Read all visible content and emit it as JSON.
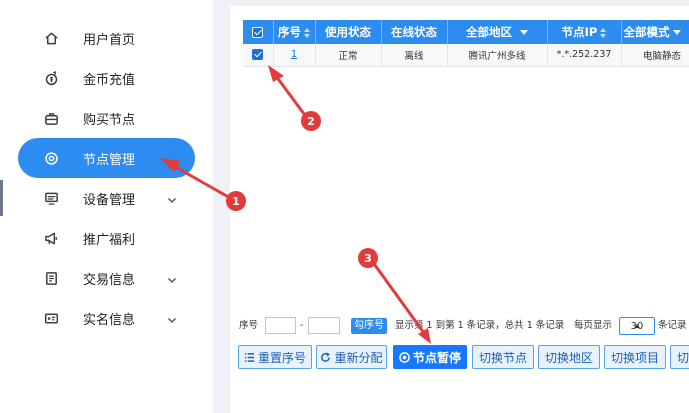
{
  "sidebar": {
    "items": [
      {
        "label": "用户首页",
        "icon": "home-icon"
      },
      {
        "label": "金币充值",
        "icon": "coin-icon"
      },
      {
        "label": "购买节点",
        "icon": "briefcase-icon"
      },
      {
        "label": "节点管理",
        "icon": "node-icon",
        "active": true
      },
      {
        "label": "设备管理",
        "icon": "monitor-icon",
        "expandable": true
      },
      {
        "label": "推广福利",
        "icon": "megaphone-icon"
      },
      {
        "label": "交易信息",
        "icon": "document-icon",
        "expandable": true
      },
      {
        "label": "实名信息",
        "icon": "id-card-icon",
        "expandable": true
      }
    ],
    "active_color": "#2d8cf0"
  },
  "table": {
    "headers": [
      "序号",
      "使用状态",
      "在线状态",
      "全部地区",
      "节点IP",
      "全部模式"
    ],
    "rows": [
      {
        "index": "1",
        "use_status": "正常",
        "online_status": "离线",
        "region": "腾讯广州多线",
        "ip": "*.*.252.237",
        "mode": "电脑静态",
        "checked": true
      }
    ]
  },
  "pager": {
    "seq_label": "序号",
    "range_sep": "-",
    "check_btn": "勾序号",
    "display_text": "显示第 1 到第 1 条记录，总共 1 条记录",
    "per_page_prefix": "每页显示",
    "per_page_value": "30",
    "per_page_suffix": "条记录"
  },
  "actions": {
    "reset_index": "重置序号",
    "redistribute": "重新分配",
    "pause_node": "节点暂停",
    "switch_node": "切换节点",
    "switch_region": "切换地区",
    "switch_project": "切换项目",
    "switch_more": "切换"
  },
  "annotations": [
    {
      "number": "1",
      "target": "节点管理"
    },
    {
      "number": "2",
      "target": "row checkbox"
    },
    {
      "number": "3",
      "target": "节点暂停"
    }
  ],
  "colors": {
    "primary": "#2d8cf0",
    "annotation": "#e23b3b",
    "online_ok": "#1a8b2a",
    "offline": "#e02020"
  }
}
